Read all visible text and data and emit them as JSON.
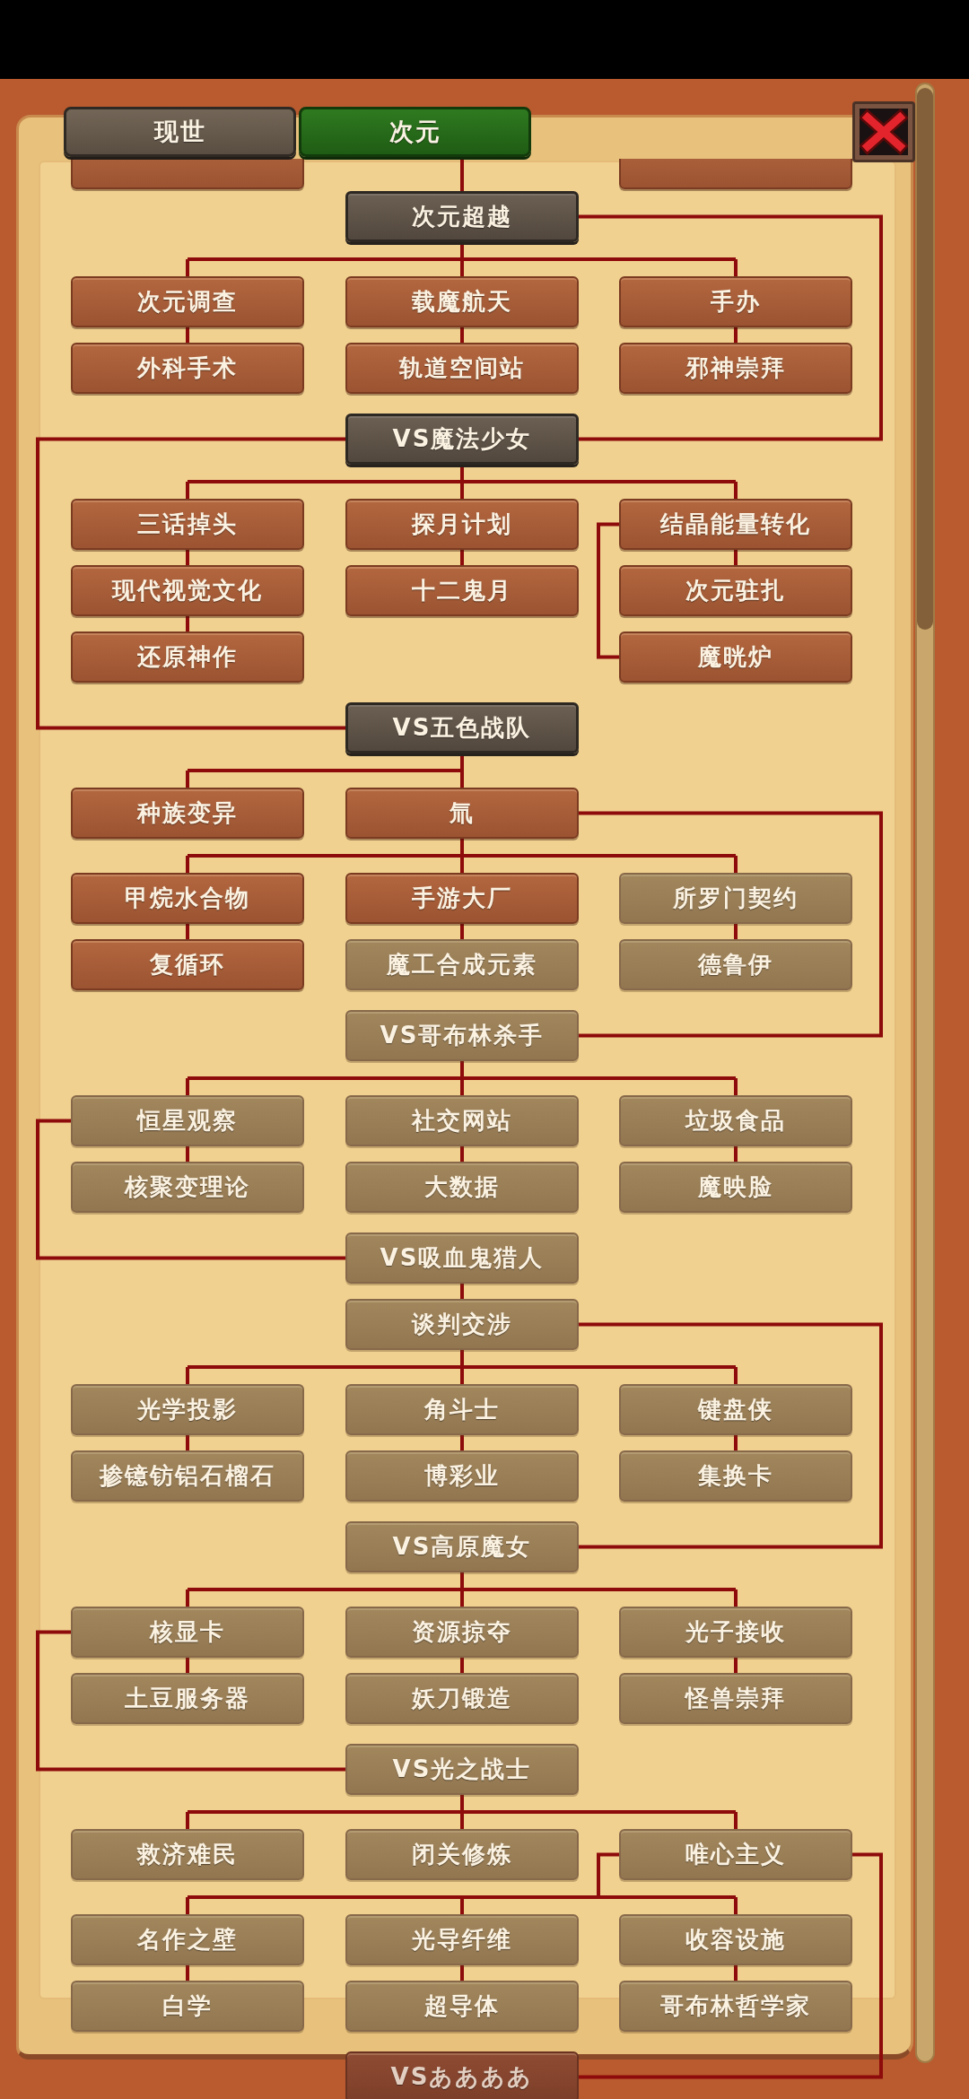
{
  "tabs": [
    {
      "label": "现世",
      "selected": false
    },
    {
      "label": "次元",
      "selected": true
    }
  ],
  "tech_tree": {
    "previous_row": [
      {
        "researched": true
      },
      {
        "researched": true
      }
    ],
    "root": {
      "label": "次元超越",
      "researched": true,
      "branches": [
        [
          {
            "label": "次元调查",
            "researched": true
          },
          {
            "label": "外科手术",
            "researched": true
          }
        ],
        [
          {
            "label": "载魔航天",
            "researched": true
          },
          {
            "label": "轨道空间站",
            "researched": true
          }
        ],
        [
          {
            "label": "手办",
            "researched": true
          },
          {
            "label": "邪神崇拜",
            "researched": true
          }
        ]
      ],
      "unlocks": {
        "label": "VS魔法少女",
        "researched": true,
        "branches": [
          [
            {
              "label": "三话掉头",
              "researched": true
            },
            {
              "label": "现代视觉文化",
              "researched": true
            },
            {
              "label": "还原神作",
              "researched": true
            }
          ],
          [
            {
              "label": "探月计划",
              "researched": true
            },
            {
              "label": "十二鬼月",
              "researched": true
            }
          ],
          [
            {
              "label": "结晶能量转化",
              "researched": true,
              "side": [
                {
                  "label": "魔晄炉",
                  "researched": true
                }
              ]
            },
            {
              "label": "次元驻扎",
              "researched": true
            }
          ]
        ],
        "unlocks": {
          "label": "VS五色战队",
          "researched": true,
          "branches": [
            [
              {
                "label": "种族变异",
                "researched": true
              }
            ],
            [
              {
                "label": "氚",
                "researched": true,
                "branches": [
                  [
                    {
                      "label": "甲烷水合物",
                      "researched": true
                    },
                    {
                      "label": "复循环",
                      "researched": true
                    }
                  ],
                  [
                    {
                      "label": "手游大厂",
                      "researched": true
                    },
                    {
                      "label": "魔工合成元素",
                      "researched": false
                    }
                  ],
                  [
                    {
                      "label": "所罗门契约",
                      "researched": false
                    },
                    {
                      "label": "德鲁伊",
                      "researched": false
                    }
                  ]
                ],
                "unlocks": {
                  "label": "VS哥布林杀手",
                  "researched": false,
                  "branches": [
                    [
                      {
                        "label": "恒星观察",
                        "researched": false,
                        "unlocks": {
                          "label": "VS吸血鬼猎人",
                          "researched": false,
                          "branches": [
                            [
                              {
                                "label": "谈判交涉",
                                "researched": false,
                                "branches": [
                                  [
                                    {
                                      "label": "光学投影",
                                      "researched": false
                                    },
                                    {
                                      "label": "掺镱钫铝石榴石",
                                      "researched": false
                                    }
                                  ],
                                  [
                                    {
                                      "label": "角斗士",
                                      "researched": false
                                    },
                                    {
                                      "label": "博彩业",
                                      "researched": false
                                    }
                                  ],
                                  [
                                    {
                                      "label": "键盘侠",
                                      "researched": false
                                    },
                                    {
                                      "label": "集换卡",
                                      "researched": false
                                    }
                                  ]
                                ],
                                "unlocks": {
                                  "label": "VS高原魔女",
                                  "researched": false,
                                  "branches": [
                                    [
                                      {
                                        "label": "核显卡",
                                        "researched": false,
                                        "unlocks": {
                                          "label": "VS光之战士",
                                          "researched": false,
                                          "branches": [
                                            [
                                              {
                                                "label": "救济难民",
                                                "researched": false
                                              }
                                            ],
                                            [
                                              {
                                                "label": "闭关修炼",
                                                "researched": false
                                              }
                                            ],
                                            [
                                              {
                                                "label": "唯心主义",
                                                "researched": false,
                                                "branches": [
                                                  [
                                                    {
                                                      "label": "名作之壁",
                                                      "researched": false
                                                    },
                                                    {
                                                      "label": "白学",
                                                      "researched": false
                                                    }
                                                  ],
                                                  [
                                                    {
                                                      "label": "光导纤维",
                                                      "researched": false
                                                    },
                                                    {
                                                      "label": "超导体",
                                                      "researched": false
                                                    }
                                                  ],
                                                  [
                                                    {
                                                      "label": "收容设施",
                                                      "researched": false
                                                    },
                                                    {
                                                      "label": "哥布林哲学家",
                                                      "researched": false
                                                    }
                                                  ]
                                                ],
                                                "unlocks": {
                                                  "label": "VSああああ",
                                                  "researched": false
                                                }
                                              }
                                            ]
                                          ]
                                        }
                                      },
                                      {
                                        "label": "土豆服务器",
                                        "researched": false
                                      }
                                    ],
                                    [
                                      {
                                        "label": "资源掠夺",
                                        "researched": false
                                      },
                                      {
                                        "label": "妖刀锻造",
                                        "researched": false
                                      }
                                    ],
                                    [
                                      {
                                        "label": "光子接收",
                                        "researched": false
                                      },
                                      {
                                        "label": "怪兽崇拜",
                                        "researched": false
                                      }
                                    ]
                                  ]
                                }
                              }
                            ]
                          ]
                        }
                      },
                      {
                        "label": "核聚变理论",
                        "researched": false
                      }
                    ],
                    [
                      {
                        "label": "社交网站",
                        "researched": false
                      },
                      {
                        "label": "大数据",
                        "researched": false
                      }
                    ],
                    [
                      {
                        "label": "垃圾食品",
                        "researched": false
                      },
                      {
                        "label": "魔映脸",
                        "researched": false
                      }
                    ]
                  ]
                }
              }
            ]
          ]
        }
      }
    }
  }
}
